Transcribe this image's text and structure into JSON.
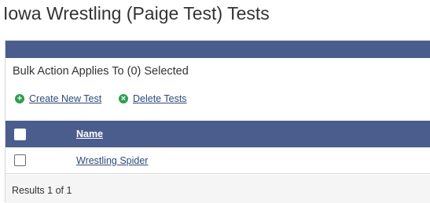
{
  "page": {
    "title": "Iowa Wrestling (Paige Test) Tests"
  },
  "bulk": {
    "text": "Bulk Action Applies To (0) Selected"
  },
  "actions": {
    "create": {
      "label": "Create New Test",
      "icon": "plus-circle-icon"
    },
    "delete": {
      "label": "Delete Tests",
      "icon": "x-circle-icon"
    }
  },
  "table": {
    "columns": [
      "Name"
    ],
    "rows": [
      {
        "name": "Wrestling Spider",
        "selected": false
      }
    ],
    "results": "Results 1 of 1"
  },
  "colors": {
    "header": "#4b5d8c",
    "link": "#2e4a7a",
    "action_icon": "#2e9e4f"
  }
}
